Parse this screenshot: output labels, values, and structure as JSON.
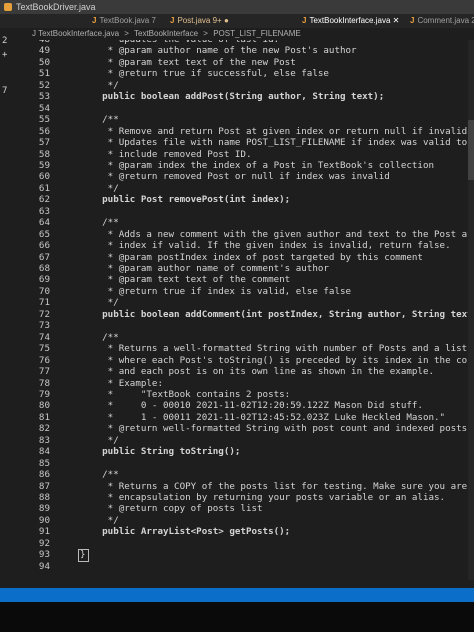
{
  "window": {
    "title": "TextBookDriver.java"
  },
  "tabs": [
    {
      "label": "TextBook.java",
      "badge": "7",
      "state": "normal"
    },
    {
      "label": "Post.java",
      "badge": "9+",
      "state": "modified"
    },
    {
      "label": "TextBookInterface.java",
      "badge": "",
      "state": "active"
    },
    {
      "label": "Comment.java",
      "badge": "2",
      "state": "normal"
    }
  ],
  "breadcrumb": [
    "J TextBookInterface.java",
    ">",
    "TextBookInterface",
    ">",
    "POST_LIST_FILENAME"
  ],
  "left_markers": [
    "2",
    "+",
    "7"
  ],
  "lines": [
    {
      "n": "48",
      "t": "     * updates the value of last id."
    },
    {
      "n": "49",
      "t": "     * @param author name of the new Post's author"
    },
    {
      "n": "50",
      "t": "     * @param text text of the new Post"
    },
    {
      "n": "51",
      "t": "     * @return true if successful, else false"
    },
    {
      "n": "52",
      "t": "     */"
    },
    {
      "n": "53",
      "t": "    public boolean addPost(String author, String text);"
    },
    {
      "n": "54",
      "t": ""
    },
    {
      "n": "55",
      "t": "    /**"
    },
    {
      "n": "56",
      "t": "     * Remove and return Post at given index or return null if invalid index."
    },
    {
      "n": "57",
      "t": "     * Updates file with name POST_LIST_FILENAME if index was valid to no longer"
    },
    {
      "n": "58",
      "t": "     * include removed Post ID."
    },
    {
      "n": "59",
      "t": "     * @param index the index of a Post in TextBook's collection"
    },
    {
      "n": "60",
      "t": "     * @return removed Post or null if index was invalid"
    },
    {
      "n": "61",
      "t": "     */"
    },
    {
      "n": "62",
      "t": "    public Post removePost(int index);"
    },
    {
      "n": "63",
      "t": ""
    },
    {
      "n": "64",
      "t": "    /**"
    },
    {
      "n": "65",
      "t": "     * Adds a new comment with the given author and text to the Post at the given"
    },
    {
      "n": "66",
      "t": "     * index if valid. If the given index is invalid, return false."
    },
    {
      "n": "67",
      "t": "     * @param postIndex index of post targeted by this comment"
    },
    {
      "n": "68",
      "t": "     * @param author name of comment's author"
    },
    {
      "n": "69",
      "t": "     * @param text text of the comment"
    },
    {
      "n": "70",
      "t": "     * @return true if index is valid, else false"
    },
    {
      "n": "71",
      "t": "     */"
    },
    {
      "n": "72",
      "t": "    public boolean addComment(int postIndex, String author, String text);"
    },
    {
      "n": "73",
      "t": ""
    },
    {
      "n": "74",
      "t": "    /**"
    },
    {
      "n": "75",
      "t": "     * Returns a well-formatted String with number of Posts and a list of Posts"
    },
    {
      "n": "76",
      "t": "     * where each Post's toString() is preceded by its index in the collection"
    },
    {
      "n": "77",
      "t": "     * and each post is on its own line as shown in the example."
    },
    {
      "n": "78",
      "t": "     * Example:"
    },
    {
      "n": "79",
      "t": "     *     \"TextBook contains 2 posts:"
    },
    {
      "n": "80",
      "t": "     *     0 - 00010 2021-11-02T12:20:59.122Z Mason Did stuff."
    },
    {
      "n": "81",
      "t": "     *     1 - 00011 2021-11-02T12:45:52.023Z Luke Heckled Mason.\""
    },
    {
      "n": "82",
      "t": "     * @return well-formatted String with post count and indexed posts"
    },
    {
      "n": "83",
      "t": "     */"
    },
    {
      "n": "84",
      "t": "    public String toString();"
    },
    {
      "n": "85",
      "t": ""
    },
    {
      "n": "86",
      "t": "    /**"
    },
    {
      "n": "87",
      "t": "     * Returns a COPY of the posts list for testing. Make sure you are not violating"
    },
    {
      "n": "88",
      "t": "     * encapsulation by returning your posts variable or an alias."
    },
    {
      "n": "89",
      "t": "     * @return copy of posts list"
    },
    {
      "n": "90",
      "t": "     */"
    },
    {
      "n": "91",
      "t": "    public ArrayList<Post> getPosts();"
    },
    {
      "n": "92",
      "t": ""
    },
    {
      "n": "93",
      "t": "}"
    },
    {
      "n": "94",
      "t": ""
    }
  ],
  "colors": {
    "editor_bg": "#1e1e1e",
    "status_bar": "#0b6fc9",
    "java_icon": "#e8a13a"
  }
}
